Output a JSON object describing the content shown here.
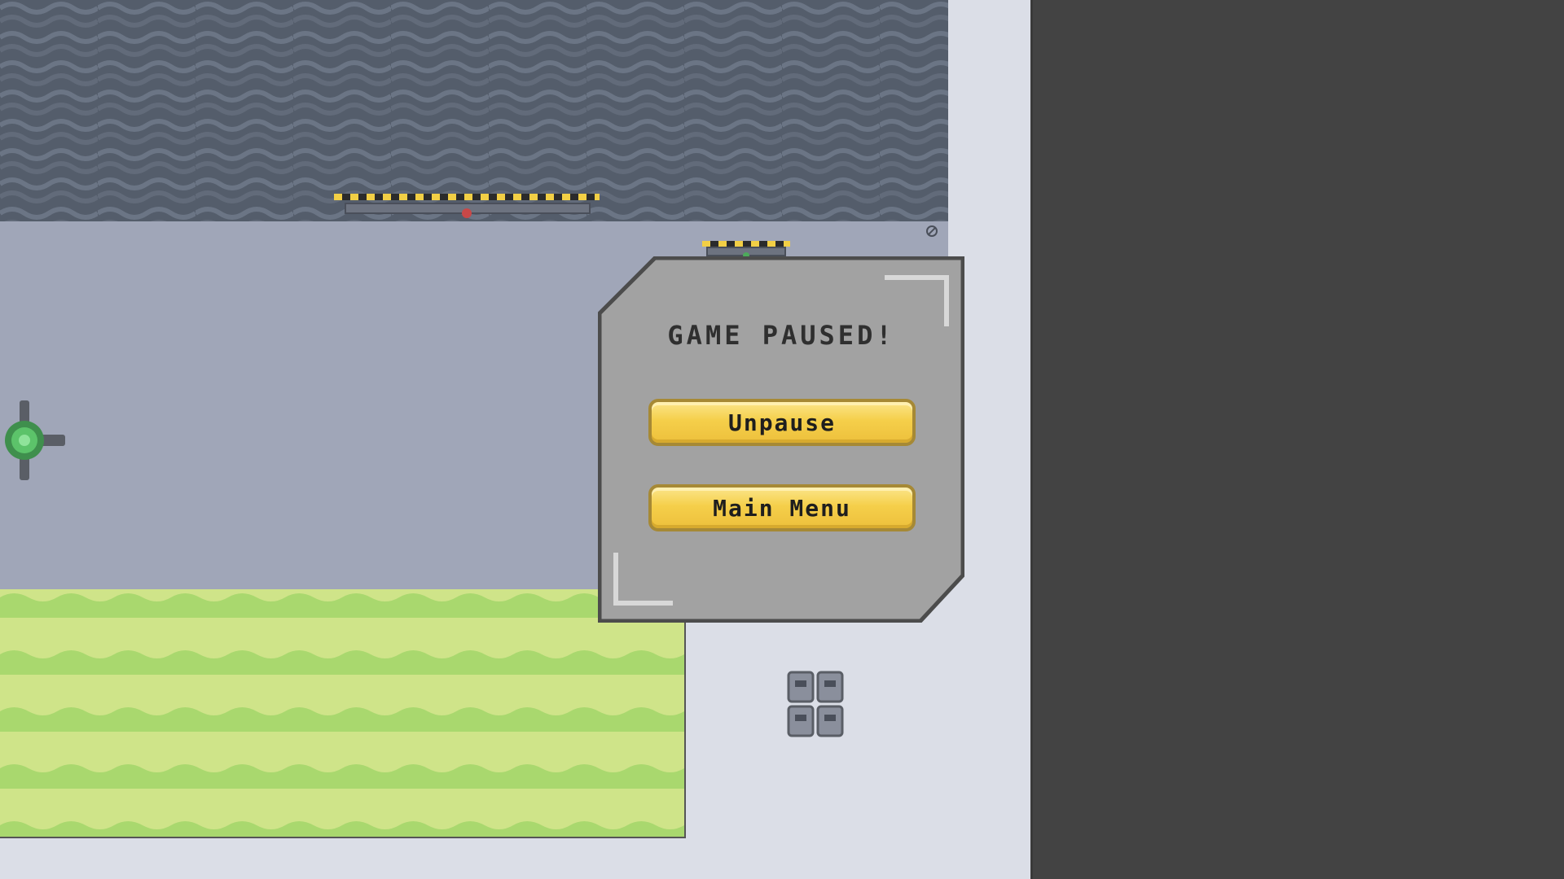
{
  "pause_menu": {
    "title": "GAME PAUSED!",
    "unpause_label": "Unpause",
    "main_menu_label": "Main Menu"
  },
  "icons": {
    "reactor": "green-orb-turret-icon",
    "vent": "vent-grate-icon",
    "close": "close-icon",
    "hazard": "hazard-stripe-platform-icon"
  },
  "colors": {
    "accent_button": "#f5cf4a",
    "panel": "#a2a2a2",
    "acid": "#a9d86e",
    "ceiling": "#545d6b",
    "room": "#a0a6b8",
    "background": "#434343"
  }
}
